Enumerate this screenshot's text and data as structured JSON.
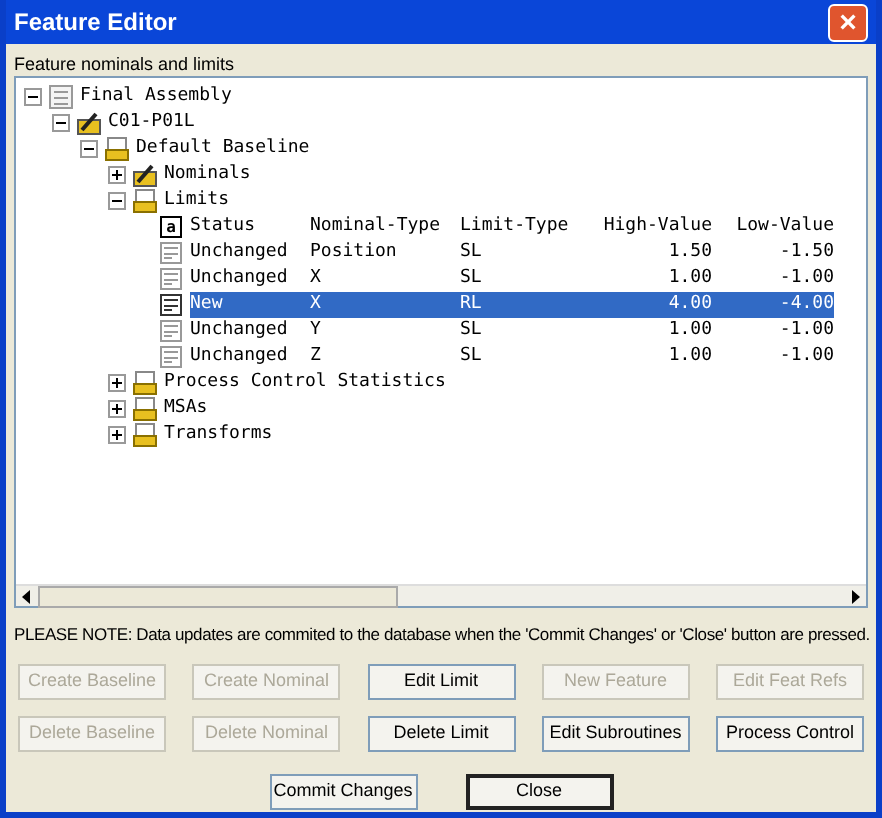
{
  "window": {
    "title": "Feature Editor",
    "close": "×"
  },
  "tree_label": "Feature nominals and limits",
  "tree": [
    {
      "label": "Final Assembly",
      "kind": "assembly",
      "expanded": true,
      "children": [
        {
          "label": "C01-P01L",
          "kind": "part",
          "expanded": true,
          "children": [
            {
              "label": "Default Baseline",
              "kind": "group",
              "expanded": true,
              "children": [
                {
                  "label": "Nominals",
                  "kind": "part",
                  "expanded": false
                },
                {
                  "label": "Limits",
                  "kind": "group",
                  "expanded": true,
                  "table": {
                    "header_icon": "a",
                    "columns": [
                      "Status",
                      "Nominal-Type",
                      "Limit-Type",
                      "High-Value",
                      "Low-Value"
                    ],
                    "rows": [
                      {
                        "cells": [
                          "Unchanged",
                          "Position",
                          "SL",
                          "1.50",
                          "-1.50"
                        ],
                        "selected": false
                      },
                      {
                        "cells": [
                          "Unchanged",
                          "X",
                          "SL",
                          "1.00",
                          "-1.00"
                        ],
                        "selected": false
                      },
                      {
                        "cells": [
                          "New",
                          "X",
                          "RL",
                          "4.00",
                          "-4.00"
                        ],
                        "selected": true
                      },
                      {
                        "cells": [
                          "Unchanged",
                          "Y",
                          "SL",
                          "1.00",
                          "-1.00"
                        ],
                        "selected": false
                      },
                      {
                        "cells": [
                          "Unchanged",
                          "Z",
                          "SL",
                          "1.00",
                          "-1.00"
                        ],
                        "selected": false
                      }
                    ]
                  }
                },
                {
                  "label": "Process Control Statistics",
                  "kind": "group",
                  "expanded": false
                },
                {
                  "label": "MSAs",
                  "kind": "group",
                  "expanded": false
                },
                {
                  "label": "Transforms",
                  "kind": "group",
                  "expanded": false
                }
              ]
            }
          ]
        }
      ]
    }
  ],
  "note": "PLEASE NOTE: Data updates are commited to the database when the 'Commit Changes' or 'Close' button are pressed.",
  "button_rows": [
    [
      {
        "label": "Create Baseline",
        "disabled": true
      },
      {
        "label": "Create Nominal",
        "disabled": true
      },
      {
        "label": "Edit Limit",
        "disabled": false
      },
      {
        "label": "New Feature",
        "disabled": true
      },
      {
        "label": "Edit Feat Refs",
        "disabled": true
      }
    ],
    [
      {
        "label": "Delete Baseline",
        "disabled": true
      },
      {
        "label": "Delete Nominal",
        "disabled": true
      },
      {
        "label": "Delete Limit",
        "disabled": false
      },
      {
        "label": "Edit Subroutines",
        "disabled": false
      },
      {
        "label": "Process Control",
        "disabled": false
      }
    ]
  ],
  "footer_buttons": [
    {
      "label": "Commit Changes",
      "default": false
    },
    {
      "label": "Close",
      "default": true
    }
  ]
}
